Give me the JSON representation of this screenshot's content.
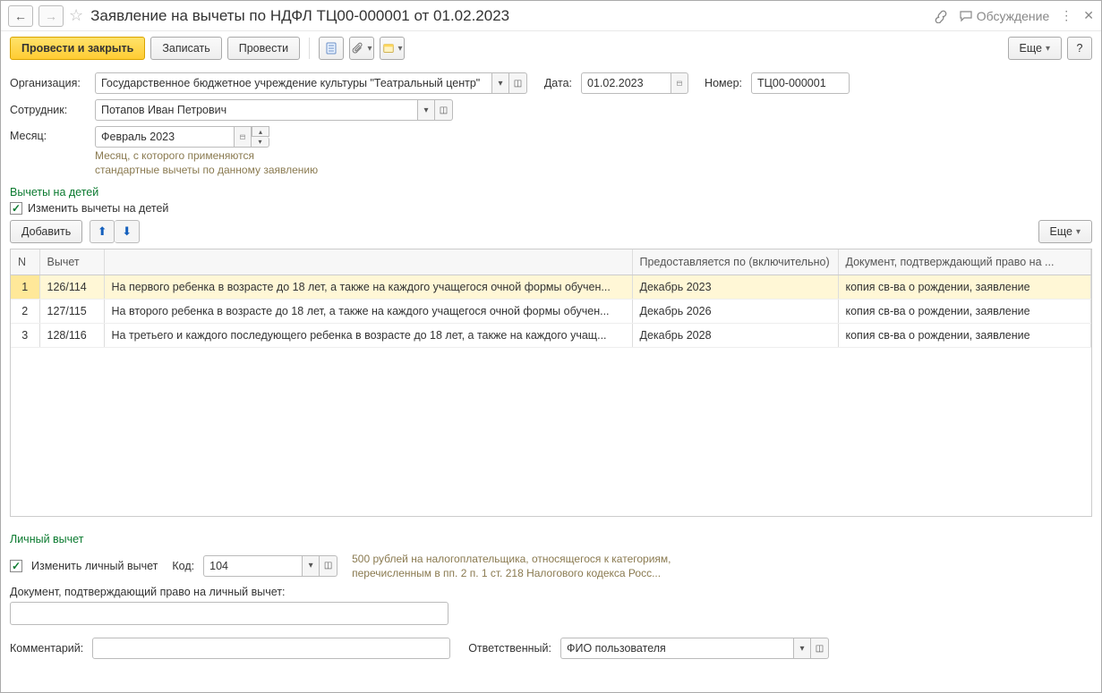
{
  "header": {
    "title": "Заявление на вычеты по НДФЛ ТЦ00-000001 от 01.02.2023",
    "discussion": "Обсуждение"
  },
  "toolbar": {
    "post_close": "Провести и закрыть",
    "write": "Записать",
    "post": "Провести",
    "more": "Еще"
  },
  "form": {
    "org_label": "Организация:",
    "org_value": "Государственное бюджетное учреждение культуры \"Театральный центр\"",
    "date_label": "Дата:",
    "date_value": "01.02.2023",
    "number_label": "Номер:",
    "number_value": "ТЦ00-000001",
    "emp_label": "Сотрудник:",
    "emp_value": "Потапов Иван Петрович",
    "month_label": "Месяц:",
    "month_value": "Февраль 2023",
    "month_hint1": "Месяц, с которого применяются",
    "month_hint2": "стандартные вычеты по данному заявлению"
  },
  "children": {
    "section": "Вычеты на детей",
    "change_label": "Изменить вычеты на детей",
    "add": "Добавить",
    "more": "Еще",
    "cols": {
      "n": "N",
      "code": "Вычет",
      "until": "Предоставляется по (включительно)",
      "doc": "Документ, подтверждающий право на ..."
    },
    "rows": [
      {
        "n": "1",
        "code": "126/114",
        "desc": "На первого ребенка в возрасте до 18 лет, а также на каждого учащегося очной формы обучен...",
        "until": "Декабрь 2023",
        "doc": "копия св-ва о рождении, заявление"
      },
      {
        "n": "2",
        "code": "127/115",
        "desc": "На второго ребенка в возрасте до 18 лет, а также на каждого учащегося очной формы обучен...",
        "until": "Декабрь 2026",
        "doc": "копия св-ва о рождении, заявление"
      },
      {
        "n": "3",
        "code": "128/116",
        "desc": "На третьего и каждого последующего ребенка в возрасте до 18 лет, а также на каждого учащ...",
        "until": "Декабрь 2028",
        "doc": "копия св-ва о рождении, заявление"
      }
    ]
  },
  "personal": {
    "section": "Личный вычет",
    "change_label": "Изменить личный вычет",
    "code_label": "Код:",
    "code_value": "104",
    "hint1": "500 рублей на налогоплательщика, относящегося к категориям,",
    "hint2": "перечисленным в пп. 2 п. 1 ст. 218 Налогового кодекса Росс...",
    "doc_label": "Документ, подтверждающий право на личный вычет:"
  },
  "footer": {
    "comment_label": "Комментарий:",
    "resp_label": "Ответственный:",
    "resp_value": "ФИО пользователя"
  }
}
